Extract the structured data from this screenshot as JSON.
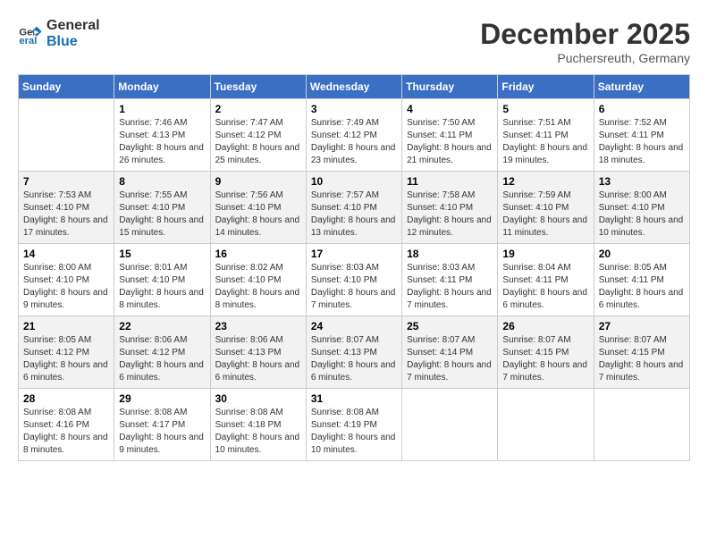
{
  "logo": {
    "line1": "General",
    "line2": "Blue"
  },
  "title": {
    "month_year": "December 2025",
    "location": "Puchersreuth, Germany"
  },
  "days_of_week": [
    "Sunday",
    "Monday",
    "Tuesday",
    "Wednesday",
    "Thursday",
    "Friday",
    "Saturday"
  ],
  "weeks": [
    [
      {
        "day": "",
        "sunrise": "",
        "sunset": "",
        "daylight": ""
      },
      {
        "day": "1",
        "sunrise": "Sunrise: 7:46 AM",
        "sunset": "Sunset: 4:13 PM",
        "daylight": "Daylight: 8 hours and 26 minutes."
      },
      {
        "day": "2",
        "sunrise": "Sunrise: 7:47 AM",
        "sunset": "Sunset: 4:12 PM",
        "daylight": "Daylight: 8 hours and 25 minutes."
      },
      {
        "day": "3",
        "sunrise": "Sunrise: 7:49 AM",
        "sunset": "Sunset: 4:12 PM",
        "daylight": "Daylight: 8 hours and 23 minutes."
      },
      {
        "day": "4",
        "sunrise": "Sunrise: 7:50 AM",
        "sunset": "Sunset: 4:11 PM",
        "daylight": "Daylight: 8 hours and 21 minutes."
      },
      {
        "day": "5",
        "sunrise": "Sunrise: 7:51 AM",
        "sunset": "Sunset: 4:11 PM",
        "daylight": "Daylight: 8 hours and 19 minutes."
      },
      {
        "day": "6",
        "sunrise": "Sunrise: 7:52 AM",
        "sunset": "Sunset: 4:11 PM",
        "daylight": "Daylight: 8 hours and 18 minutes."
      }
    ],
    [
      {
        "day": "7",
        "sunrise": "Sunrise: 7:53 AM",
        "sunset": "Sunset: 4:10 PM",
        "daylight": "Daylight: 8 hours and 17 minutes."
      },
      {
        "day": "8",
        "sunrise": "Sunrise: 7:55 AM",
        "sunset": "Sunset: 4:10 PM",
        "daylight": "Daylight: 8 hours and 15 minutes."
      },
      {
        "day": "9",
        "sunrise": "Sunrise: 7:56 AM",
        "sunset": "Sunset: 4:10 PM",
        "daylight": "Daylight: 8 hours and 14 minutes."
      },
      {
        "day": "10",
        "sunrise": "Sunrise: 7:57 AM",
        "sunset": "Sunset: 4:10 PM",
        "daylight": "Daylight: 8 hours and 13 minutes."
      },
      {
        "day": "11",
        "sunrise": "Sunrise: 7:58 AM",
        "sunset": "Sunset: 4:10 PM",
        "daylight": "Daylight: 8 hours and 12 minutes."
      },
      {
        "day": "12",
        "sunrise": "Sunrise: 7:59 AM",
        "sunset": "Sunset: 4:10 PM",
        "daylight": "Daylight: 8 hours and 11 minutes."
      },
      {
        "day": "13",
        "sunrise": "Sunrise: 8:00 AM",
        "sunset": "Sunset: 4:10 PM",
        "daylight": "Daylight: 8 hours and 10 minutes."
      }
    ],
    [
      {
        "day": "14",
        "sunrise": "Sunrise: 8:00 AM",
        "sunset": "Sunset: 4:10 PM",
        "daylight": "Daylight: 8 hours and 9 minutes."
      },
      {
        "day": "15",
        "sunrise": "Sunrise: 8:01 AM",
        "sunset": "Sunset: 4:10 PM",
        "daylight": "Daylight: 8 hours and 8 minutes."
      },
      {
        "day": "16",
        "sunrise": "Sunrise: 8:02 AM",
        "sunset": "Sunset: 4:10 PM",
        "daylight": "Daylight: 8 hours and 8 minutes."
      },
      {
        "day": "17",
        "sunrise": "Sunrise: 8:03 AM",
        "sunset": "Sunset: 4:10 PM",
        "daylight": "Daylight: 8 hours and 7 minutes."
      },
      {
        "day": "18",
        "sunrise": "Sunrise: 8:03 AM",
        "sunset": "Sunset: 4:11 PM",
        "daylight": "Daylight: 8 hours and 7 minutes."
      },
      {
        "day": "19",
        "sunrise": "Sunrise: 8:04 AM",
        "sunset": "Sunset: 4:11 PM",
        "daylight": "Daylight: 8 hours and 6 minutes."
      },
      {
        "day": "20",
        "sunrise": "Sunrise: 8:05 AM",
        "sunset": "Sunset: 4:11 PM",
        "daylight": "Daylight: 8 hours and 6 minutes."
      }
    ],
    [
      {
        "day": "21",
        "sunrise": "Sunrise: 8:05 AM",
        "sunset": "Sunset: 4:12 PM",
        "daylight": "Daylight: 8 hours and 6 minutes."
      },
      {
        "day": "22",
        "sunrise": "Sunrise: 8:06 AM",
        "sunset": "Sunset: 4:12 PM",
        "daylight": "Daylight: 8 hours and 6 minutes."
      },
      {
        "day": "23",
        "sunrise": "Sunrise: 8:06 AM",
        "sunset": "Sunset: 4:13 PM",
        "daylight": "Daylight: 8 hours and 6 minutes."
      },
      {
        "day": "24",
        "sunrise": "Sunrise: 8:07 AM",
        "sunset": "Sunset: 4:13 PM",
        "daylight": "Daylight: 8 hours and 6 minutes."
      },
      {
        "day": "25",
        "sunrise": "Sunrise: 8:07 AM",
        "sunset": "Sunset: 4:14 PM",
        "daylight": "Daylight: 8 hours and 7 minutes."
      },
      {
        "day": "26",
        "sunrise": "Sunrise: 8:07 AM",
        "sunset": "Sunset: 4:15 PM",
        "daylight": "Daylight: 8 hours and 7 minutes."
      },
      {
        "day": "27",
        "sunrise": "Sunrise: 8:07 AM",
        "sunset": "Sunset: 4:15 PM",
        "daylight": "Daylight: 8 hours and 7 minutes."
      }
    ],
    [
      {
        "day": "28",
        "sunrise": "Sunrise: 8:08 AM",
        "sunset": "Sunset: 4:16 PM",
        "daylight": "Daylight: 8 hours and 8 minutes."
      },
      {
        "day": "29",
        "sunrise": "Sunrise: 8:08 AM",
        "sunset": "Sunset: 4:17 PM",
        "daylight": "Daylight: 8 hours and 9 minutes."
      },
      {
        "day": "30",
        "sunrise": "Sunrise: 8:08 AM",
        "sunset": "Sunset: 4:18 PM",
        "daylight": "Daylight: 8 hours and 10 minutes."
      },
      {
        "day": "31",
        "sunrise": "Sunrise: 8:08 AM",
        "sunset": "Sunset: 4:19 PM",
        "daylight": "Daylight: 8 hours and 10 minutes."
      },
      {
        "day": "",
        "sunrise": "",
        "sunset": "",
        "daylight": ""
      },
      {
        "day": "",
        "sunrise": "",
        "sunset": "",
        "daylight": ""
      },
      {
        "day": "",
        "sunrise": "",
        "sunset": "",
        "daylight": ""
      }
    ]
  ]
}
